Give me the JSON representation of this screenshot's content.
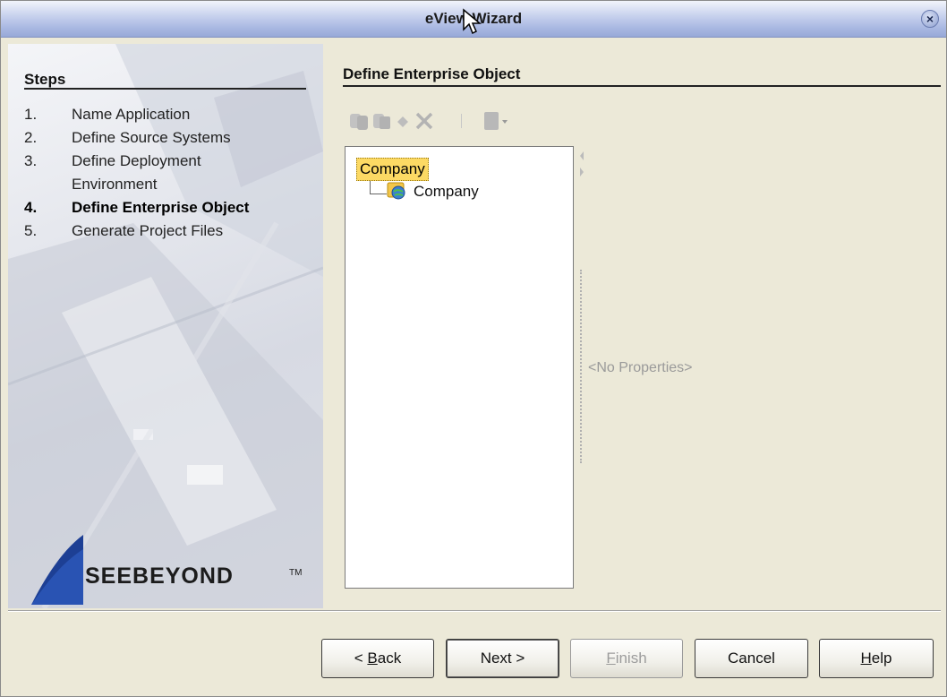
{
  "window": {
    "title": "eView Wizard"
  },
  "steps": {
    "heading": "Steps",
    "items": [
      {
        "num": "1.",
        "label": "Name Application",
        "active": false
      },
      {
        "num": "2.",
        "label": "Define Source Systems",
        "active": false
      },
      {
        "num": "3.",
        "label": "Define Deployment",
        "active": false
      },
      {
        "num": "",
        "label": "Environment",
        "active": false
      },
      {
        "num": "4.",
        "label": "Define Enterprise Object",
        "active": true
      },
      {
        "num": "5.",
        "label": "Generate Project Files",
        "active": false
      }
    ]
  },
  "branding": {
    "logo_text": "SEEBEYOND",
    "trademark": "TM"
  },
  "main": {
    "section_title": "Define Enterprise Object",
    "toolbar_icons": [
      "copy-icon",
      "paste-icon",
      "add-field-icon",
      "delete-icon",
      "template-dropdown-icon"
    ],
    "tree": {
      "root_label": "Company",
      "children": [
        {
          "label": "Company",
          "icon": "object-node-icon"
        }
      ]
    },
    "properties_placeholder": "<No Properties>"
  },
  "buttons": {
    "back": {
      "prefix": "< ",
      "mnemonic": "B",
      "rest": "ack"
    },
    "next": "Next >",
    "finish": {
      "mnemonic": "F",
      "rest": "inish"
    },
    "cancel": "Cancel",
    "help": {
      "mnemonic": "H",
      "rest": "elp"
    }
  },
  "colors": {
    "selection": "#fcd964",
    "titlebar": "#a9b8e2",
    "background": "#ece9d8"
  }
}
